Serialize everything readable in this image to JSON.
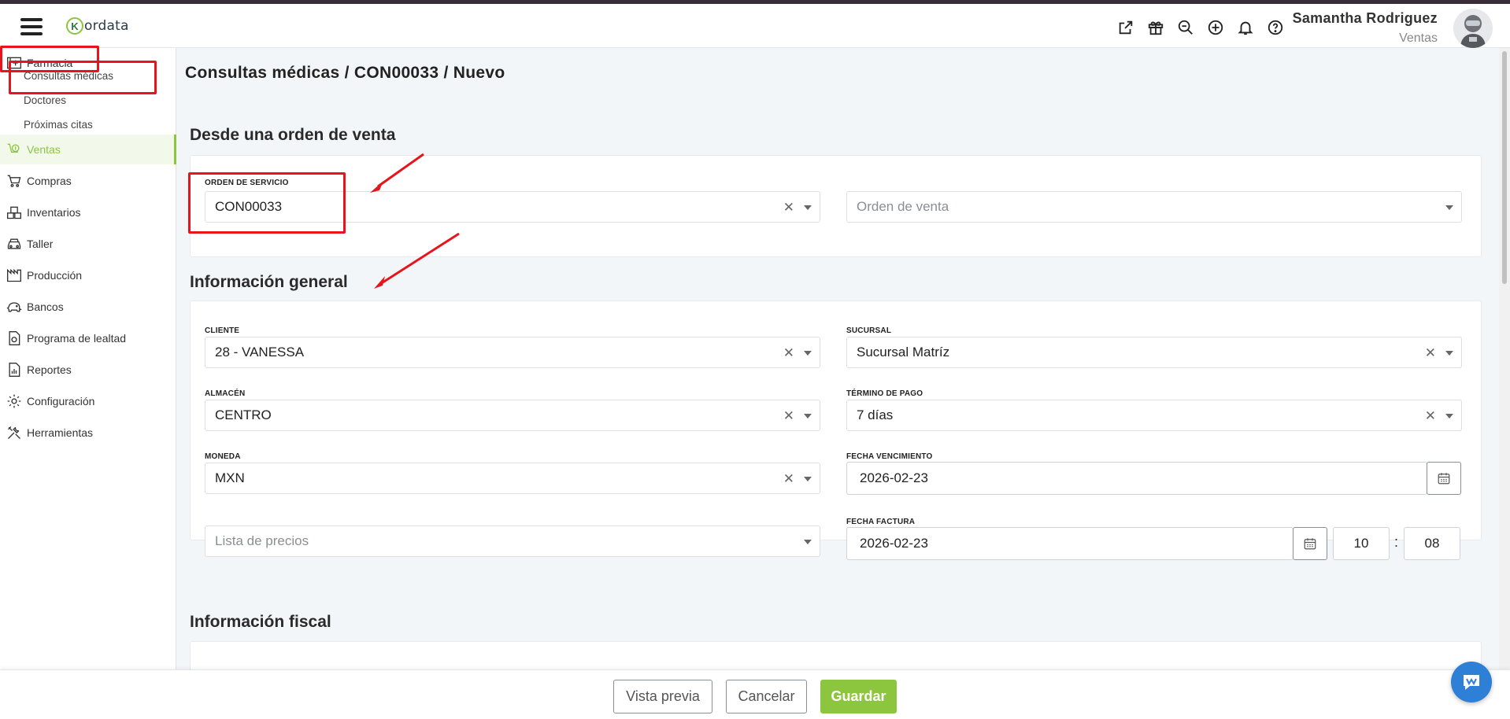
{
  "app": {
    "logo_letter": "K",
    "logo_text": "ordata"
  },
  "user": {
    "name": "Samantha Rodriguez",
    "role": "Ventas"
  },
  "sidebar": {
    "farmacia": "Farmacia",
    "sub": [
      "Consultas médicas",
      "Doctores",
      "Próximas citas"
    ],
    "items": [
      "Ventas",
      "Compras",
      "Inventarios",
      "Taller",
      "Producción",
      "Bancos",
      "Programa de lealtad",
      "Reportes",
      "Configuración",
      "Herramientas"
    ]
  },
  "breadcrumb": "Consultas médicas /  CON00033 /  Nuevo",
  "sections": {
    "desde": "Desde una orden de venta",
    "general": "Información general",
    "fiscal": "Información fiscal"
  },
  "desde": {
    "orden_servicio_label": "ORDEN DE SERVICIO",
    "orden_servicio_value": "CON00033",
    "orden_venta_placeholder": "Orden de venta"
  },
  "general": {
    "cliente_label": "CLIENTE",
    "cliente_value": "28 - VANESSA",
    "sucursal_label": "SUCURSAL",
    "sucursal_value": "Sucursal Matríz",
    "almacen_label": "ALMACÉN",
    "almacen_value": "CENTRO",
    "termino_label": "TÉRMINO DE PAGO",
    "termino_value": "7 días",
    "moneda_label": "MONEDA",
    "moneda_value": "MXN",
    "vencimiento_label": "FECHA VENCIMIENTO",
    "vencimiento_value": "2026-02-23",
    "lista_placeholder": "Lista de precios",
    "factura_label": "FECHA FACTURA",
    "factura_value": "2026-02-23",
    "hour": "10",
    "minute": "08"
  },
  "footer": {
    "preview": "Vista previa",
    "cancel": "Cancelar",
    "save": "Guardar"
  },
  "colors": {
    "accent": "#8cc63f",
    "highlight": "#e8141c"
  }
}
